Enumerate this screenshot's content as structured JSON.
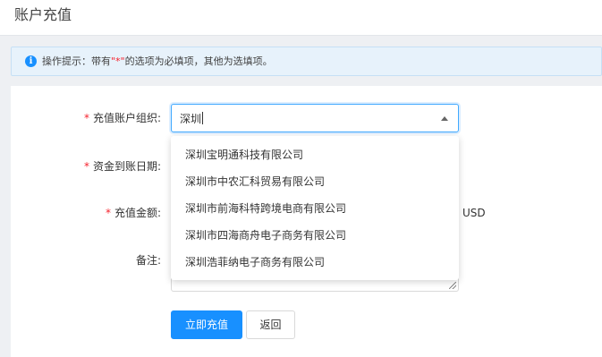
{
  "page": {
    "title": "账户充值"
  },
  "tip": {
    "prefix": "操作提示：带有",
    "star": "\"*\"",
    "suffix": "的选项为必填项，其他为选填项。"
  },
  "form": {
    "required_mark": "*",
    "org": {
      "label": "充值账户组织:",
      "value": "深圳",
      "options": [
        "深圳宝明通科技有限公司",
        "深圳市中农汇科贸易有限公司",
        "深圳市前海科特跨境电商有限公司",
        "深圳市四海商舟电子商务有限公司",
        "深圳浩菲纳电子商务有限公司"
      ]
    },
    "date": {
      "label": "资金到账日期:"
    },
    "amount": {
      "label": "充值金额:",
      "unit": "USD"
    },
    "remark": {
      "label": "备注:"
    }
  },
  "actions": {
    "submit_label": "立即充值",
    "back_label": "返回"
  }
}
